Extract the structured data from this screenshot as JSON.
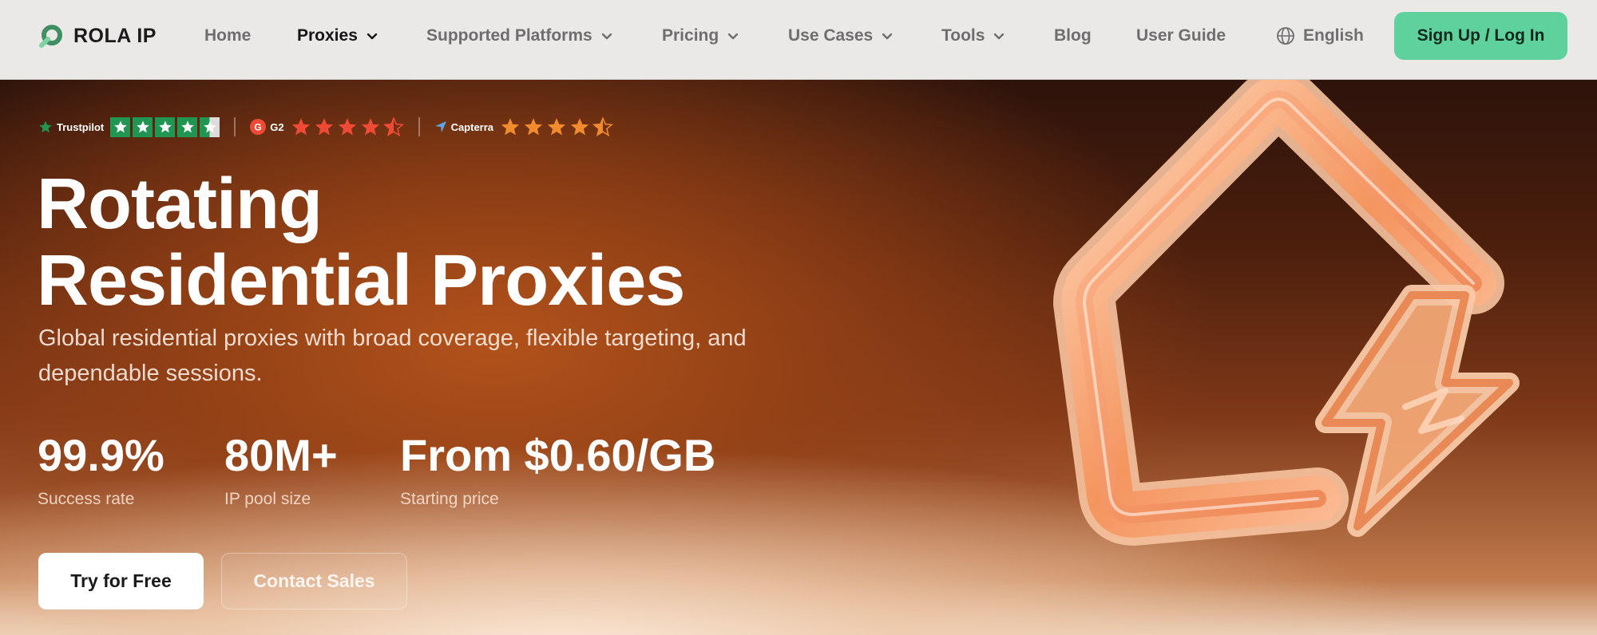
{
  "brand": {
    "name": "ROLA IP",
    "accent": "#5fd19c"
  },
  "nav": {
    "items": [
      {
        "label": "Home",
        "dropdown": false,
        "active": false
      },
      {
        "label": "Proxies",
        "dropdown": true,
        "active": true
      },
      {
        "label": "Supported Platforms",
        "dropdown": true,
        "active": false
      },
      {
        "label": "Pricing",
        "dropdown": true,
        "active": false
      },
      {
        "label": "Use Cases",
        "dropdown": true,
        "active": false
      },
      {
        "label": "Tools",
        "dropdown": true,
        "active": false
      },
      {
        "label": "Blog",
        "dropdown": false,
        "active": false
      },
      {
        "label": "User Guide",
        "dropdown": false,
        "active": false
      }
    ],
    "language": "English",
    "cta": "Sign Up / Log In"
  },
  "ratings": [
    {
      "source": "Trustpilot",
      "stars": 4.5,
      "color": "#219653"
    },
    {
      "source": "G2",
      "stars": 4.5,
      "color": "#ef4a35"
    },
    {
      "source": "Capterra",
      "stars": 4.5,
      "color": "#f28a2e"
    }
  ],
  "hero": {
    "title_line1": "Rotating",
    "title_line2": "Residential Proxies",
    "subtitle": "Global residential proxies with broad coverage, flexible targeting, and dependable sessions.",
    "stats": [
      {
        "value": "99.9%",
        "label": "Success rate"
      },
      {
        "value": "80M+",
        "label": "IP pool size"
      },
      {
        "value": "From $0.60/GB",
        "label": "Starting price"
      }
    ],
    "primary_button": "Try for Free",
    "secondary_button": "Contact Sales"
  }
}
